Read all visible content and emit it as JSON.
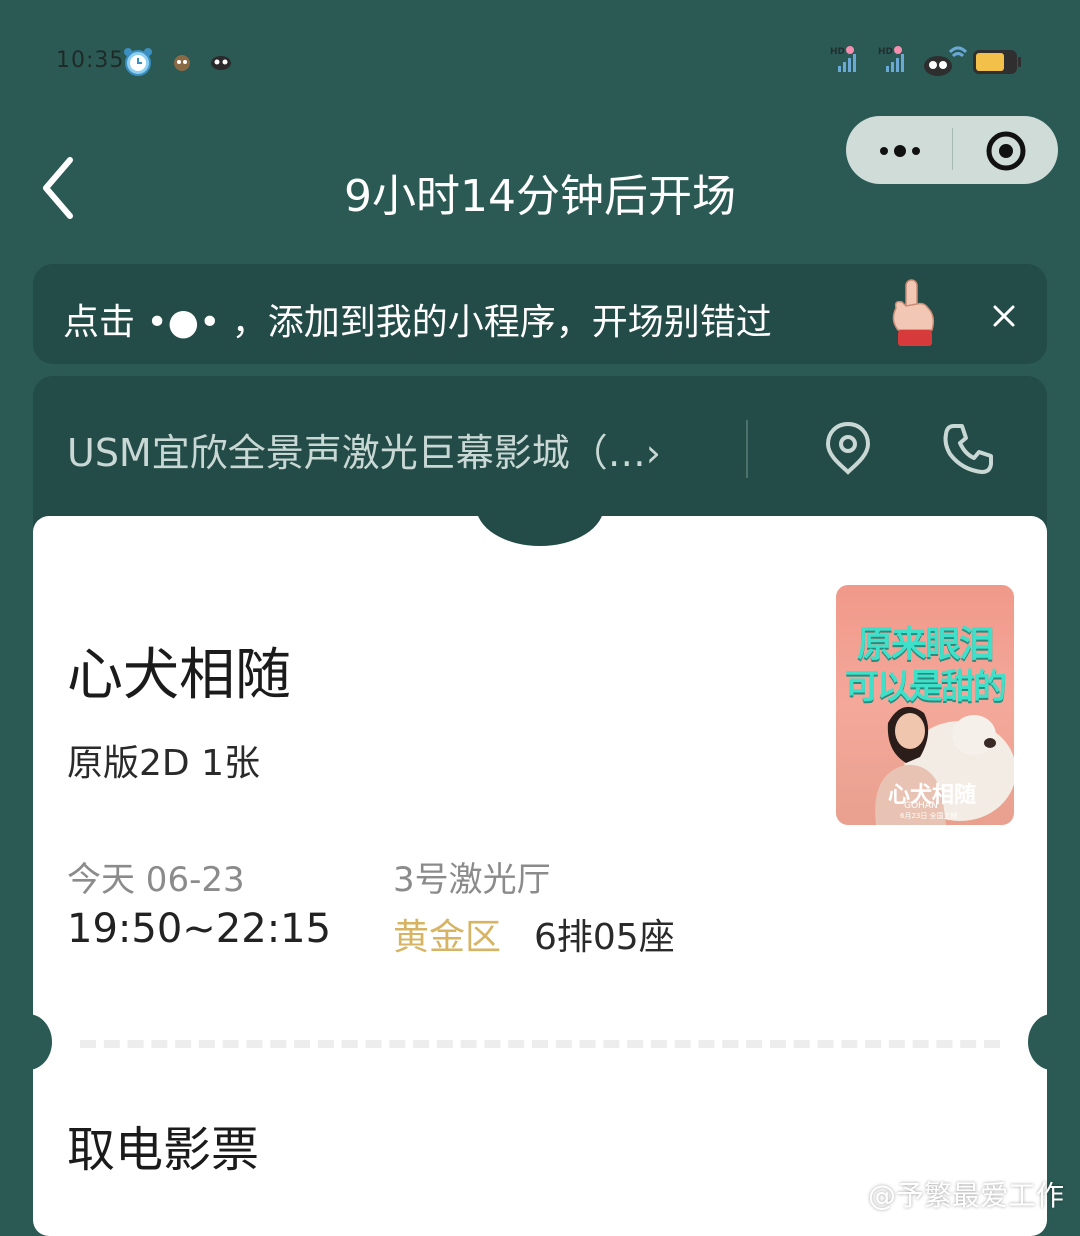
{
  "status_bar": {
    "time": "10:35",
    "icons": [
      "alarm-icon",
      "emoji-icon",
      "emoji-icon",
      "signal-hd-icon",
      "signal-hd-icon",
      "wifi-icon",
      "battery-icon"
    ]
  },
  "header": {
    "title": "9小时14分钟后开场",
    "back_icon": "chevron-left-icon",
    "capsule_icons": [
      "more-dots-icon",
      "target-icon"
    ]
  },
  "tip": {
    "text": "点击 •●• ，添加到我的小程序，开场别错过",
    "close_label": "×"
  },
  "cinema": {
    "name": "USM宜欣全景声激光巨幕影城（…›",
    "icons": [
      "location-icon",
      "phone-icon"
    ]
  },
  "ticket": {
    "movie_title": "心犬相随",
    "format": "原版2D 1张",
    "date": "今天 06-23",
    "time": "19:50~22:15",
    "hall": "3号激光厅",
    "zone": "黄金区",
    "seat": "6排05座",
    "pickup_title": "取电影票"
  },
  "poster": {
    "line1": "原来眼泪",
    "line2": "可以是甜的",
    "movie_title": "心犬相随",
    "english": "GOHAN",
    "release": "6月23日 全国上映"
  },
  "watermark": "@予繁最爱工作",
  "colors": {
    "background": "#2b5a55",
    "panel": "#234b47",
    "zone": "#d6b463",
    "capsule": "#cfdcd8"
  }
}
